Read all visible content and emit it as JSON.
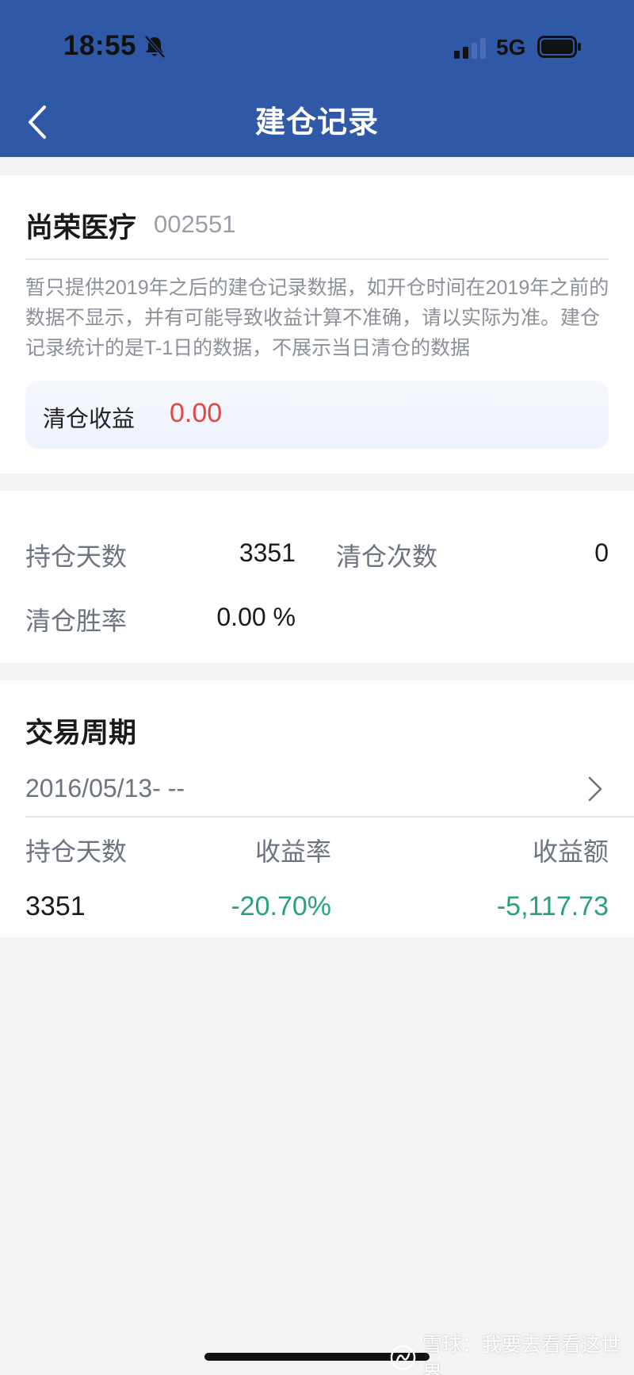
{
  "status_bar": {
    "time": "18:55",
    "network": "5G",
    "icons": [
      "bell-slash-icon",
      "signal-icon",
      "battery-icon"
    ]
  },
  "nav": {
    "title": "建仓记录",
    "back_icon": "chevron-left-icon"
  },
  "stock": {
    "name": "尚荣医疗",
    "code": "002551",
    "notice": "暂只提供2019年之后的建仓记录数据，如开仓时间在2019年之前的数据不显示，并有可能导致收益计算不准确，请以实际为准。建仓记录统计的是T-1日的数据，不展示当日清仓的数据",
    "clear_profit_label": "清仓收益",
    "clear_profit_value": "0.00"
  },
  "stats": {
    "hold_days_label": "持仓天数",
    "hold_days_value": "3351",
    "clear_count_label": "清仓次数",
    "clear_count_value": "0",
    "win_rate_label": "清仓胜率",
    "win_rate_value": "0.00 %"
  },
  "cycle": {
    "title": "交易周期",
    "period": "2016/05/13- --",
    "columns": [
      "持仓天数",
      "收益率",
      "收益额"
    ],
    "rows": [
      {
        "hold_days": "3351",
        "return_rate": "-20.70%",
        "return_amount": "-5,117.73"
      }
    ]
  },
  "watermark": {
    "text": "雪球：我要去看看这世界"
  },
  "colors": {
    "header_bg": "#2f59a6",
    "loss_green": "#27a27a",
    "profit_red": "#e04747",
    "page_bg": "#f2f3f5"
  }
}
